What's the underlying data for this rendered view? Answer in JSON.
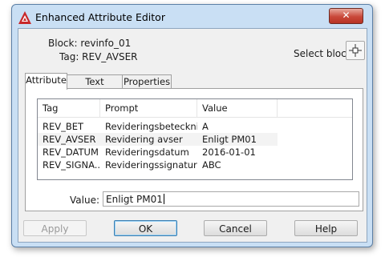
{
  "window": {
    "title": "Enhanced Attribute Editor",
    "close_symbol": "✕",
    "icon": "autocad-icon"
  },
  "info": {
    "block_label": "Block: revinfo_01",
    "tag_label": "Tag: REV_AVSER",
    "select_block_label": "Select block"
  },
  "tabs": [
    {
      "label": "Attribute",
      "active": true
    },
    {
      "label": "Text Options",
      "active": false
    },
    {
      "label": "Properties",
      "active": false
    }
  ],
  "table": {
    "columns": [
      "Tag",
      "Prompt",
      "Value"
    ],
    "rows": [
      {
        "tag": "REV_BET",
        "prompt": "Revideringsbetecknі...",
        "value": "A"
      },
      {
        "tag": "REV_AVSER",
        "prompt": "Revidering avser",
        "value": "Enligt PM01"
      },
      {
        "tag": "REV_DATUM",
        "prompt": "Revideringsdatum",
        "value": "2016-01-01"
      },
      {
        "tag": "REV_SIGNA...",
        "prompt": "Revideringssignatur",
        "value": "ABC"
      }
    ],
    "selected_row": 1
  },
  "value_field": {
    "label": "Value:",
    "value": "Enligt PM01"
  },
  "buttons": {
    "apply": "Apply",
    "ok": "OK",
    "cancel": "Cancel",
    "help": "Help"
  },
  "colors": {
    "frame": "#c9dff4",
    "close": "#c9483a",
    "default_button": "#3c7fb1"
  }
}
